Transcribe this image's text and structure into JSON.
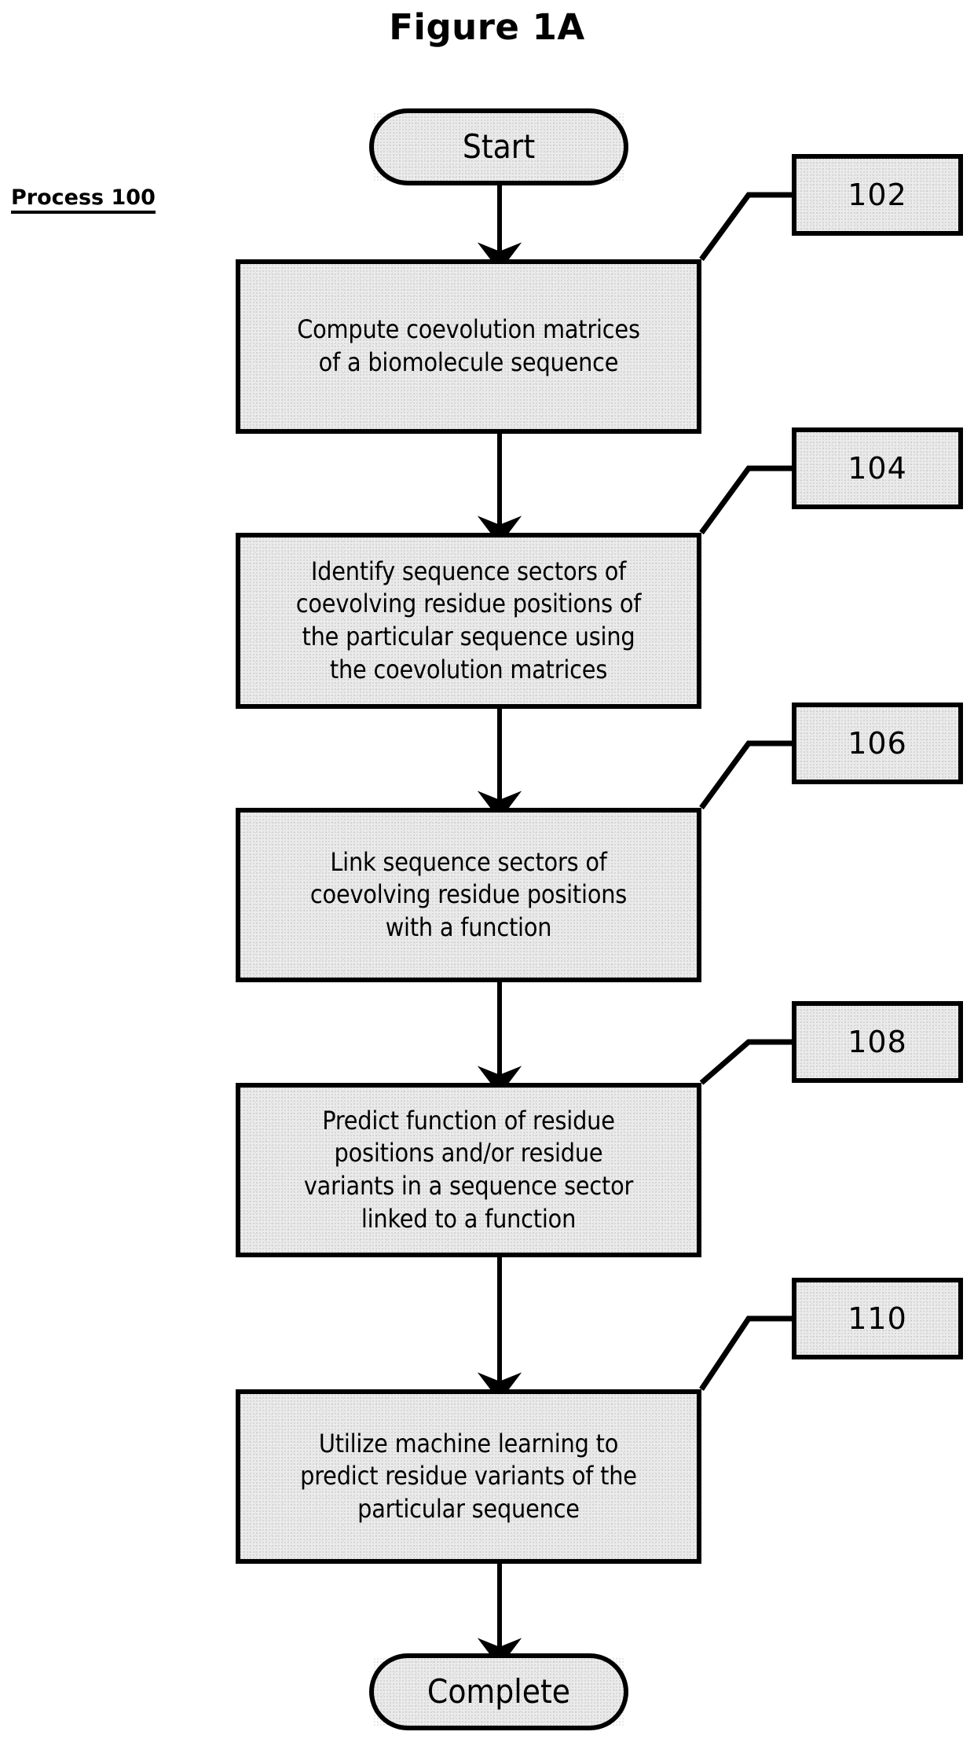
{
  "figure": {
    "title": "Figure 1A",
    "process_label": "Process 100"
  },
  "flowchart": {
    "type": "flowchart",
    "orientation": "top-to-bottom",
    "fill_color": "#ebebeb",
    "stroke_color": "#000000",
    "nodes": [
      {
        "id": "start",
        "shape": "terminator",
        "label": "Start"
      },
      {
        "id": "s102",
        "shape": "process",
        "label": "Compute coevolution matrices\nof a biomolecule sequence",
        "ref": "102"
      },
      {
        "id": "s104",
        "shape": "process",
        "label": "Identify sequence sectors of\ncoevolving residue positions of\nthe particular sequence using\nthe coevolution matrices",
        "ref": "104"
      },
      {
        "id": "s106",
        "shape": "process",
        "label": "Link sequence sectors of\ncoevolving residue positions\nwith a function",
        "ref": "106"
      },
      {
        "id": "s108",
        "shape": "process",
        "label": "Predict function of residue\npositions and/or residue\nvariants in a sequence sector\nlinked to a function",
        "ref": "108"
      },
      {
        "id": "s110",
        "shape": "process",
        "label": "Utilize machine learning to\npredict residue variants of the\nparticular sequence",
        "ref": "110"
      },
      {
        "id": "end",
        "shape": "terminator",
        "label": "Complete"
      }
    ],
    "reference_numerals": [
      {
        "id": "ref102",
        "text": "102",
        "points_to": "s102"
      },
      {
        "id": "ref104",
        "text": "104",
        "points_to": "s104"
      },
      {
        "id": "ref106",
        "text": "106",
        "points_to": "s106"
      },
      {
        "id": "ref108",
        "text": "108",
        "points_to": "s108"
      },
      {
        "id": "ref110",
        "text": "110",
        "points_to": "s110"
      }
    ],
    "edges": [
      {
        "from": "start",
        "to": "s102",
        "arrow": true
      },
      {
        "from": "s102",
        "to": "s104",
        "arrow": true
      },
      {
        "from": "s104",
        "to": "s106",
        "arrow": true
      },
      {
        "from": "s106",
        "to": "s108",
        "arrow": true
      },
      {
        "from": "s108",
        "to": "s110",
        "arrow": true
      },
      {
        "from": "s110",
        "to": "end",
        "arrow": true
      }
    ]
  }
}
